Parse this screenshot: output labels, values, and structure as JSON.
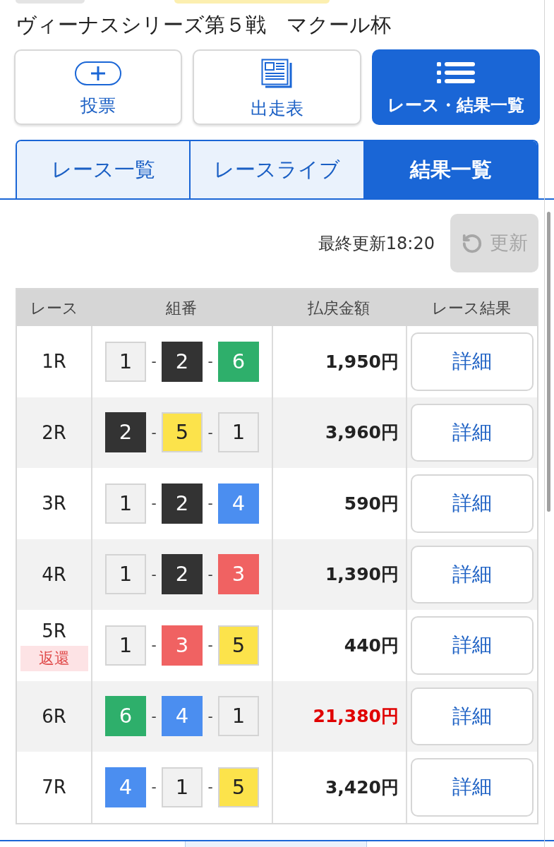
{
  "title": "ヴィーナスシリーズ第５戦　マクール杯",
  "nav_buttons": [
    {
      "label": "投票",
      "kind": "vote",
      "selected": false
    },
    {
      "label": "出走表",
      "kind": "entries",
      "selected": false
    },
    {
      "label": "レース・結果一覧",
      "kind": "results",
      "selected": true
    }
  ],
  "tabs": [
    {
      "label": "レース一覧",
      "selected": false
    },
    {
      "label": "レースライブ",
      "selected": false
    },
    {
      "label": "結果一覧",
      "selected": true
    }
  ],
  "update": {
    "label": "最終更新18:20",
    "button": "更新",
    "disabled": true
  },
  "table": {
    "columns": [
      "レース",
      "組番",
      "払戻金額",
      "レース結果"
    ],
    "rows": [
      {
        "race": "1R",
        "combination": [
          {
            "number": "1",
            "color": "#f1f1f1"
          },
          {
            "number": "2",
            "color": "#333333"
          },
          {
            "number": "6",
            "color": "#2eaf6b"
          }
        ],
        "separators": [
          "-",
          "-"
        ],
        "payout": "1,950円",
        "highlighted": false,
        "detail": "詳細"
      },
      {
        "race": "2R",
        "combination": [
          {
            "number": "2",
            "color": "#333333"
          },
          {
            "number": "5",
            "color": "#fce34b"
          },
          {
            "number": "1",
            "color": "#f1f1f1"
          }
        ],
        "separators": [
          "-",
          "-"
        ],
        "payout": "3,960円",
        "highlighted": false,
        "detail": "詳細"
      },
      {
        "race": "3R",
        "combination": [
          {
            "number": "1",
            "color": "#f1f1f1"
          },
          {
            "number": "2",
            "color": "#333333"
          },
          {
            "number": "4",
            "color": "#4b8ef0"
          }
        ],
        "separators": [
          "-",
          "-"
        ],
        "payout": "590円",
        "highlighted": false,
        "detail": "詳細"
      },
      {
        "race": "4R",
        "combination": [
          {
            "number": "1",
            "color": "#f1f1f1"
          },
          {
            "number": "2",
            "color": "#333333"
          },
          {
            "number": "3",
            "color": "#f06262"
          }
        ],
        "separators": [
          "-",
          "-"
        ],
        "payout": "1,390円",
        "highlighted": false,
        "detail": "詳細"
      },
      {
        "race": "5R",
        "badge": "返還",
        "combination": [
          {
            "number": "1",
            "color": "#f1f1f1"
          },
          {
            "number": "3",
            "color": "#f06262"
          },
          {
            "number": "5",
            "color": "#fce34b"
          }
        ],
        "separators": [
          "-",
          "-"
        ],
        "payout": "440円",
        "highlighted": false,
        "detail": "詳細"
      },
      {
        "race": "6R",
        "combination": [
          {
            "number": "6",
            "color": "#2eaf6b"
          },
          {
            "number": "4",
            "color": "#4b8ef0"
          },
          {
            "number": "1",
            "color": "#f1f1f1"
          }
        ],
        "separators": [
          "-",
          "-"
        ],
        "payout": "21,380円",
        "highlighted": true,
        "detail": "詳細"
      },
      {
        "race": "7R",
        "combination": [
          {
            "number": "4",
            "color": "#4b8ef0"
          },
          {
            "number": "1",
            "color": "#f1f1f1"
          },
          {
            "number": "5",
            "color": "#fce34b"
          }
        ],
        "separators": [
          "-",
          "-"
        ],
        "payout": "3,420円",
        "highlighted": false,
        "detail": "詳細"
      }
    ]
  }
}
